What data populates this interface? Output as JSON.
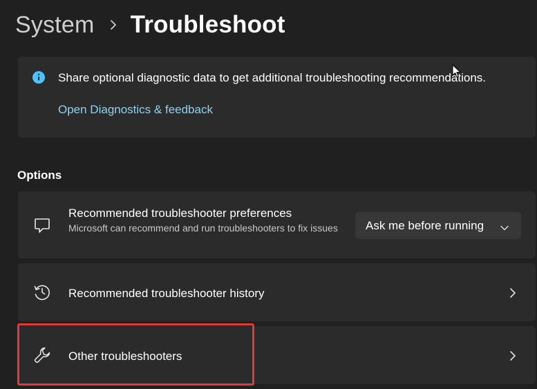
{
  "breadcrumb": {
    "parent": "System",
    "current": "Troubleshoot"
  },
  "info_card": {
    "icon": "info-icon",
    "message": "Share optional diagnostic data to get additional troubleshooting recommendations.",
    "link_label": "Open Diagnostics & feedback"
  },
  "options": {
    "section_title": "Options",
    "items": [
      {
        "icon": "chat-bubble-icon",
        "title": "Recommended troubleshooter preferences",
        "description": "Microsoft can recommend and run troubleshooters to fix issues",
        "dropdown_value": "Ask me before running"
      },
      {
        "icon": "history-icon",
        "title": "Recommended troubleshooter history"
      },
      {
        "icon": "wrench-icon",
        "title": "Other troubleshooters"
      }
    ]
  },
  "colors": {
    "background": "#202020",
    "card": "#2b2b2b",
    "accent_link": "#8fd2f0",
    "info_icon": "#4cc2ff",
    "highlight": "#e03a3a"
  }
}
